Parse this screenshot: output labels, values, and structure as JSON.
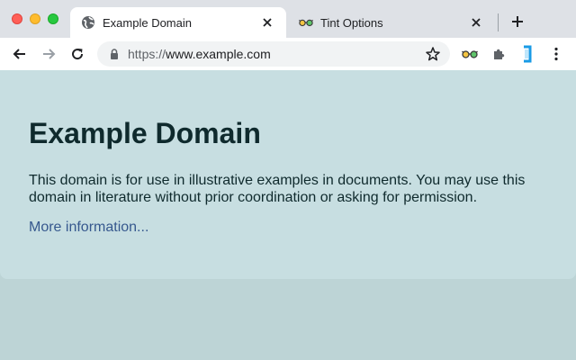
{
  "browser": {
    "tabs": [
      {
        "title": "Example Domain",
        "favicon": "globe-icon",
        "active": true
      },
      {
        "title": "Tint Options",
        "favicon": "glasses-icon",
        "active": false
      }
    ],
    "address_bar": {
      "scheme": "https://",
      "host": "www.example.com"
    },
    "extensions": [
      "glasses-icon",
      "puzzle-icon",
      "blue-bracket-icon"
    ]
  },
  "page": {
    "heading": "Example Domain",
    "paragraph": "This domain is for use in illustrative examples in documents. You may use this domain in literature without prior coordination or asking for permission.",
    "link_text": "More information..."
  },
  "colors": {
    "page_background": "#bdd4d6",
    "card_background": "#c7dee1",
    "link": "#36588e",
    "heading_text": "#0f2a2d"
  }
}
